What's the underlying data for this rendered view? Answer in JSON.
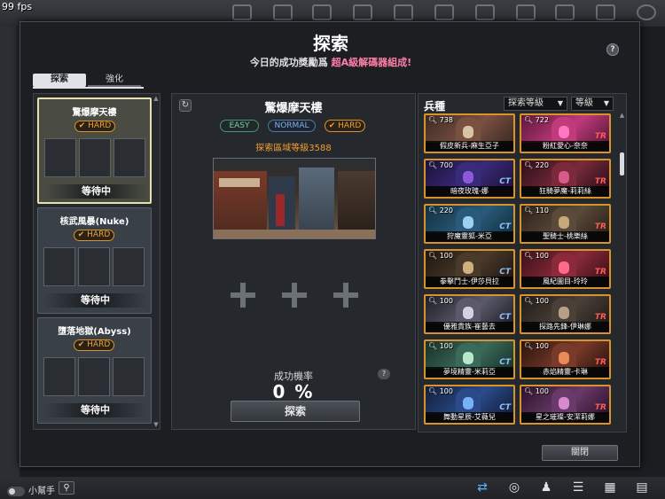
{
  "hud": {
    "fps": "99 fps"
  },
  "modal": {
    "title": "探索",
    "subtitle_prefix": "今日的成功獎勵爲",
    "subtitle_accent": "超A級解碼器組成!",
    "help_label": "?",
    "close_label": "關閉"
  },
  "tabs": [
    {
      "label": "探索",
      "active": true
    },
    {
      "label": "強化",
      "active": false
    }
  ],
  "stages": [
    {
      "name": "驚爆摩天樓",
      "difficulty": "HARD",
      "status": "等待中",
      "selected": true
    },
    {
      "name": "核武風暴(Nuke)",
      "difficulty": "HARD",
      "status": "等待中",
      "selected": false
    },
    {
      "name": "墮落地獄(Abyss)",
      "difficulty": "HARD",
      "status": "等待中",
      "selected": false
    }
  ],
  "center": {
    "refresh_icon": "↻",
    "map_title": "驚爆摩天樓",
    "difficulty_options": [
      "EASY",
      "NORMAL",
      "HARD"
    ],
    "selected_difficulty": "HARD",
    "area_level": "探索區域等級3588",
    "rate_label": "成功機率",
    "rate_help": "?",
    "rate_value": "0 %",
    "explore_button": "探索"
  },
  "units": {
    "header": "兵種",
    "sort_dropdown": "探索等級",
    "level_dropdown": "等級",
    "list": [
      {
        "power": "738",
        "name": "假皮新兵-麻生亞子",
        "side": "",
        "art": [
          "#7a5040",
          "#d9c2a8",
          "#3c2a24"
        ]
      },
      {
        "power": "722",
        "name": "粉紅愛心-奈奈",
        "side": "TR",
        "art": [
          "#c03a7c",
          "#ff77c0",
          "#5a1838"
        ]
      },
      {
        "power": "700",
        "name": "暗夜玫瑰-娜",
        "side": "CT",
        "art": [
          "#3a2a7a",
          "#8a5ad8",
          "#1c1238"
        ]
      },
      {
        "power": "220",
        "name": "狂騎夢魔-莉莉絲",
        "side": "TR",
        "art": [
          "#7a2a3a",
          "#d85a8a",
          "#2a0e18"
        ]
      },
      {
        "power": "220",
        "name": "狩魔靈狐-米亞",
        "side": "CT",
        "art": [
          "#2a5a7a",
          "#9ad0f0",
          "#123040"
        ]
      },
      {
        "power": "110",
        "name": "聖騎士-桃樂絲",
        "side": "TR",
        "art": [
          "#5a4a3a",
          "#c8a878",
          "#2a2018"
        ]
      },
      {
        "power": "100",
        "name": "拳擊鬥士-伊莎貝拉",
        "side": "CT",
        "art": [
          "#4a3a2a",
          "#d0b080",
          "#1e1610"
        ]
      },
      {
        "power": "100",
        "name": "風紀圖目-玲玲",
        "side": "TR",
        "art": [
          "#8a2a3a",
          "#ff6a8a",
          "#3a1018"
        ]
      },
      {
        "power": "100",
        "name": "優雅貴族-崔藝去",
        "side": "CT",
        "art": [
          "#5a5a6a",
          "#d8d0e0",
          "#1e1e28"
        ]
      },
      {
        "power": "100",
        "name": "探路先鋒-伊琳娜",
        "side": "TR",
        "art": [
          "#4a4038",
          "#b8a088",
          "#201a16"
        ]
      },
      {
        "power": "100",
        "name": "夢境精靈-米莉亞",
        "side": "CT",
        "art": [
          "#3a6a5a",
          "#b8e8c8",
          "#183028"
        ]
      },
      {
        "power": "100",
        "name": "赤焰精靈-卡琳",
        "side": "TR",
        "art": [
          "#7a3a2a",
          "#e88a5a",
          "#2a140e"
        ]
      },
      {
        "power": "100",
        "name": "舞動星辰-艾薇兒",
        "side": "CT",
        "art": [
          "#2a4a8a",
          "#7ab0f8",
          "#121e38"
        ]
      },
      {
        "power": "100",
        "name": "星之璀璨-安潔莉娜",
        "side": "TR",
        "art": [
          "#6a3a6a",
          "#d88ad0",
          "#2a1228"
        ]
      }
    ]
  },
  "bottom_bar": {
    "helper_label": "小幫手",
    "search_icon": "⚲"
  }
}
